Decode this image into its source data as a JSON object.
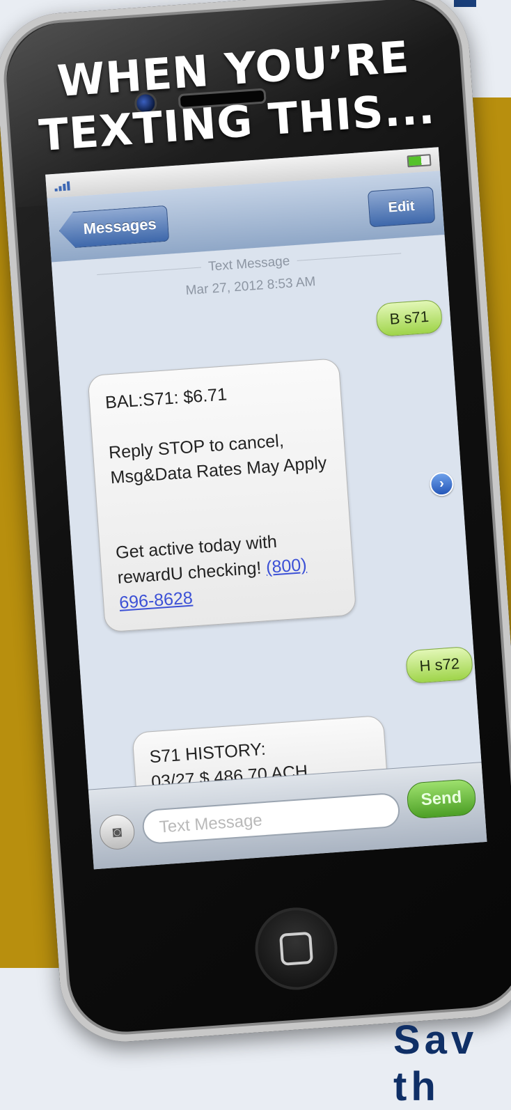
{
  "headline": {
    "line1": "WHEN YOU’RE",
    "line2": "TEXTING THIS..."
  },
  "navbar": {
    "back_label": "Messages",
    "edit_label": "Edit"
  },
  "thread": {
    "type_label": "Text Message",
    "timestamp": "Mar 27, 2012 8:53 AM",
    "messages": [
      {
        "direction": "out",
        "text": "B s71"
      },
      {
        "direction": "in",
        "lines": [
          "BAL:S71: $6.71",
          "Reply STOP to cancel, Msg&Data Rates May Apply",
          "Get active today with rewardU checking!"
        ],
        "phone": "(800) 696-8628"
      },
      {
        "direction": "out",
        "text": "H s72"
      },
      {
        "direction": "in",
        "lines": [
          "S71 HISTORY:",
          "03/27 $ 486.70   ACH"
        ]
      }
    ]
  },
  "input": {
    "placeholder": "Text Message",
    "send_label": "Send"
  },
  "icons": {
    "camera": "camera-icon",
    "disclosure": "chevron-right-icon",
    "home": "home-button-icon"
  },
  "colors": {
    "gold": "#b88f0e",
    "navy": "#0f2f66",
    "outgoing_bubble": "#9fd44a",
    "link": "#3b50d6"
  },
  "footer_fragment": "Sav th"
}
